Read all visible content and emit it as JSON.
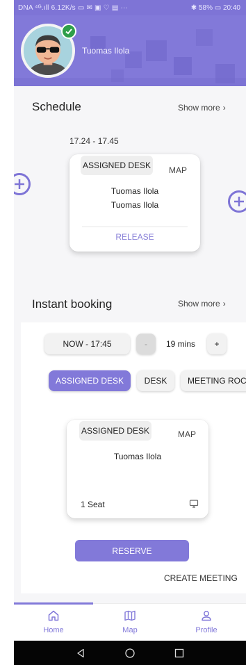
{
  "status_bar": {
    "left": "DNA ⁴ᴳ.ıll 6.12K/s ▭ ✉ ▣ ♡ ▤ ···",
    "right": "✱ 58% ▭ 20:40"
  },
  "header": {
    "user_name": "Tuomas Ilola"
  },
  "schedule": {
    "title": "Schedule",
    "show_more": "Show more",
    "time_range": "17.24 - 17.45",
    "card": {
      "tag": "ASSIGNED DESK",
      "map_label": "MAP",
      "line1": "Tuomas Ilola",
      "line2": "Tuomas Ilola",
      "release": "RELEASE"
    }
  },
  "instant_booking": {
    "title": "Instant booking",
    "show_more": "Show more",
    "time_pill": "NOW - 17:45",
    "minus": "-",
    "duration": "19 mins",
    "plus": "+",
    "filters": [
      "ASSIGNED DESK",
      "DESK",
      "MEETING ROC"
    ],
    "card": {
      "tag": "ASSIGNED DESK",
      "map_label": "MAP",
      "name": "Tuomas Ilola",
      "seats": "1 Seat"
    },
    "reserve": "RESERVE",
    "create_meeting": "CREATE MEETING"
  },
  "bottom_nav": {
    "items": [
      {
        "label": "Home",
        "icon": "home-icon"
      },
      {
        "label": "Map",
        "icon": "map-icon"
      },
      {
        "label": "Profile",
        "icon": "profile-icon"
      }
    ]
  },
  "colors": {
    "accent": "#8279d9",
    "status_bar": "#7e74d6",
    "success_badge": "#2e9e4a"
  }
}
